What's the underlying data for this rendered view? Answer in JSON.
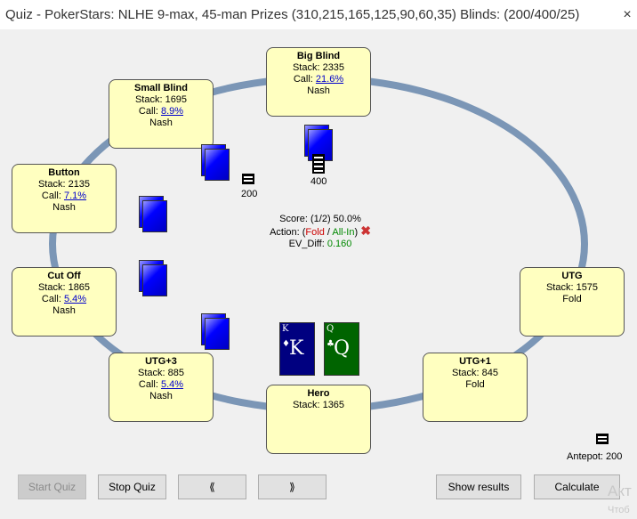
{
  "window": {
    "title": "Quiz - PokerStars: NLHE 9-max, 45-man Prizes (310,215,165,125,90,60,35) Blinds: (200/400/25)",
    "close_glyph": "×"
  },
  "seats": {
    "big_blind": {
      "name": "Big Blind",
      "stack": "Stack: 2335",
      "call_label": "Call: ",
      "call": "21.6%",
      "action": "Nash"
    },
    "small_blind": {
      "name": "Small Blind",
      "stack": "Stack: 1695",
      "call_label": "Call: ",
      "call": "8.9%",
      "action": "Nash"
    },
    "button": {
      "name": "Button",
      "stack": "Stack: 2135",
      "call_label": "Call: ",
      "call": "7.1%",
      "action": "Nash"
    },
    "cut_off": {
      "name": "Cut Off",
      "stack": "Stack: 1865",
      "call_label": "Call: ",
      "call": "5.4%",
      "action": "Nash"
    },
    "utg3": {
      "name": "UTG+3",
      "stack": "Stack: 885",
      "call_label": "Call: ",
      "call": "5.4%",
      "action": "Nash"
    },
    "hero": {
      "name": "Hero",
      "stack": "Stack: 1365"
    },
    "utg1": {
      "name": "UTG+1",
      "stack": "Stack: 845",
      "action": "Fold"
    },
    "utg": {
      "name": "UTG",
      "stack": "Stack: 1575",
      "action": "Fold"
    }
  },
  "bets": {
    "small_blind": "200",
    "big_blind": "400"
  },
  "center": {
    "score": "Score: (1/2) 50.0%",
    "action_prefix": "Action: (",
    "fold": "Fold",
    "sep": " / ",
    "allin": "All-In",
    "action_suffix": ")",
    "ev_label": "EV_Diff: ",
    "ev_value": "0.160",
    "wrong_mark": "✖"
  },
  "hero_cards": [
    {
      "rank": "K",
      "suit": "♦",
      "color": "#000080"
    },
    {
      "rank": "Q",
      "suit": "♣",
      "color": "#006400"
    }
  ],
  "antepot": "Antepot: 200",
  "buttons": {
    "start_quiz": "Start Quiz",
    "stop_quiz": "Stop Quiz",
    "prev": "⟪",
    "next": "⟫",
    "show_results": "Show results",
    "calculate": "Calculate"
  },
  "watermark": {
    "line1": "Акт",
    "line2": "Чтоб"
  },
  "colors": {
    "seat_bg": "#ffffc0",
    "table_ring": "#7b96b6",
    "card_back": "#0000ff"
  }
}
